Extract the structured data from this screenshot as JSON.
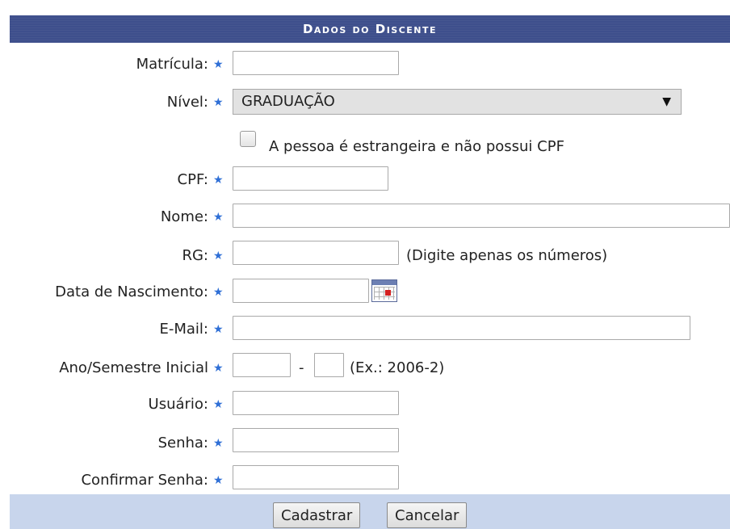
{
  "form": {
    "title": "Dados do Discente",
    "required_symbol": "★",
    "labels": {
      "matricula": "Matrícula:",
      "nivel": "Nível:",
      "cpf": "CPF:",
      "nome": "Nome:",
      "rg": "RG:",
      "nascimento": "Data de Nascimento:",
      "email": "E-Mail:",
      "ano_semestre": "Ano/Semestre Inicial",
      "usuario": "Usuário:",
      "senha": "Senha:",
      "confirmar_senha": "Confirmar Senha:"
    },
    "nivel_selected": "GRADUAÇÃO",
    "estrangeiro_label": "A pessoa é estrangeira e não possui CPF",
    "estrangeiro_checked": false,
    "rg_hint": "(Digite apenas os números)",
    "ano_separator": "-",
    "ano_hint": "(Ex.: 2006-2)",
    "values": {
      "matricula": "",
      "cpf": "",
      "nome": "",
      "rg": "",
      "nascimento": "",
      "email": "",
      "ano": "",
      "semestre": "",
      "usuario": "",
      "senha": "",
      "confirmar_senha": ""
    }
  },
  "buttons": {
    "cadastrar": "Cadastrar",
    "cancelar": "Cancelar"
  },
  "icons": {
    "required": "star-icon",
    "calendar": "calendar-icon",
    "dropdown": "chevron-down-icon"
  },
  "colors": {
    "header_bg": "#3e4f8c",
    "footer_bg": "#c8d5ec",
    "required_star": "#2f6fd6"
  }
}
